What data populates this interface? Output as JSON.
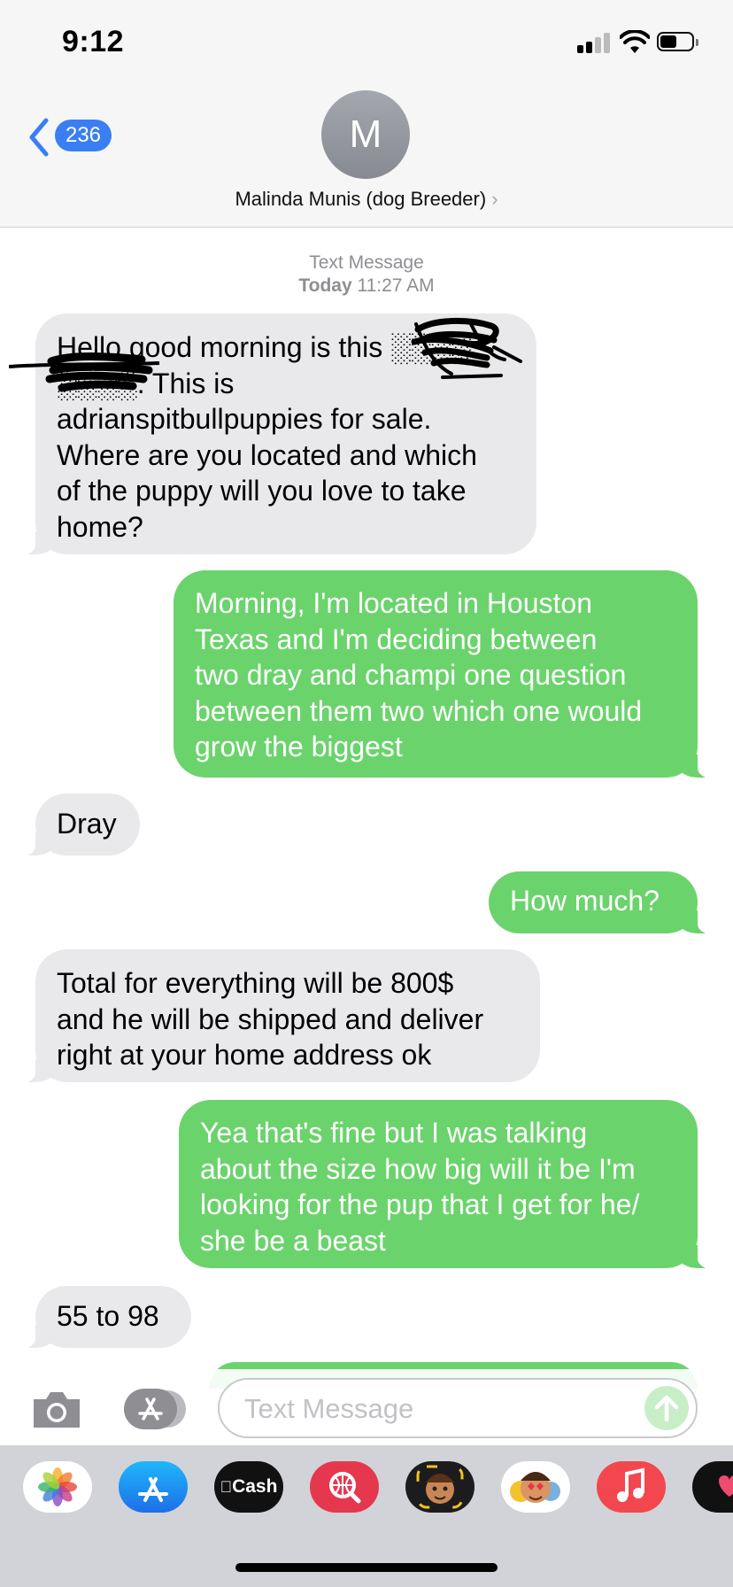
{
  "status_bar": {
    "time": "9:12"
  },
  "header": {
    "back_badge_count": "236",
    "avatar_initial": "M",
    "contact_name": "Malinda Munis (dog Breeder)"
  },
  "thread": {
    "service_label": "Text Message",
    "timestamp_day": "Today",
    "timestamp_time": "11:27 AM"
  },
  "messages": [
    {
      "direction": "incoming",
      "text": "Hello good morning is this ░░░░\n░░░░. This is\nadrianspitbullpuppies for sale.\nWhere are you located and which\nof the puppy will you love to take\nhome?"
    },
    {
      "direction": "outgoing",
      "text": "Morning, I'm located in Houston\nTexas and I'm deciding between\ntwo dray and champi one question\nbetween them two which one would\ngrow the biggest"
    },
    {
      "direction": "incoming",
      "text": "Dray"
    },
    {
      "direction": "outgoing",
      "text": "How much?"
    },
    {
      "direction": "incoming",
      "text": "Total for everything will be 800$\nand he will be shipped and deliver\nright at your home address ok"
    },
    {
      "direction": "outgoing",
      "text": "Yea that's fine but I was talking\nabout the size how big will it be I'm\nlooking for the pup that I get for he/\nshe be a beast"
    },
    {
      "direction": "incoming",
      "text": "55 to 98"
    }
  ],
  "compose": {
    "placeholder": "Text Message"
  },
  "app_drawer": {
    "apps": [
      {
        "name": "Photos",
        "icon": "photos-icon"
      },
      {
        "name": "App Store",
        "icon": "app-store-icon"
      },
      {
        "name": "Cash",
        "label": "Cash",
        "icon": "cash-app-icon"
      },
      {
        "name": "Search",
        "icon": "web-search-icon"
      },
      {
        "name": "Memoji",
        "icon": "memoji-icon"
      },
      {
        "name": "Animoji",
        "icon": "animoji-icon"
      },
      {
        "name": "Music",
        "icon": "music-icon"
      },
      {
        "name": "Digital Touch",
        "icon": "digital-touch-icon"
      }
    ]
  },
  "colors": {
    "incoming_bubble": "#e9e9eb",
    "outgoing_bubble": "#6bd36c",
    "accent_blue": "#3a7ef3"
  }
}
